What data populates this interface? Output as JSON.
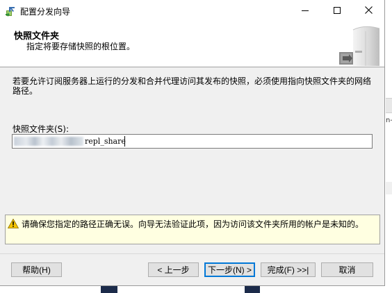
{
  "window": {
    "title": "配置分发向导"
  },
  "header": {
    "title": "快照文件夹",
    "subtitle": "指定将要存储快照的根位置。"
  },
  "body": {
    "description": "若要允许订阅服务器上运行的分发和合并代理访问其发布的快照，必须使用指向快照文件夹的网络路径。",
    "folder_label": "快照文件夹(S):",
    "folder_value": "repl_share"
  },
  "warning": {
    "text": "请确保您指定的路径正确无误。向导无法验证此项，因为访问该文件夹所用的帐户是未知的。"
  },
  "buttons": {
    "help": "帮助(H)",
    "back": "< 上一步",
    "next": "下一步(N) >",
    "finish": "完成(F) >>|",
    "cancel": "取消"
  },
  "background": {
    "fragment_text": "n-"
  },
  "icons": {
    "app": "wizard-icon",
    "header": "server-folder-icon",
    "warning": "warning-icon",
    "minimize": "minimize-icon",
    "maximize": "maximize-icon",
    "close": "close-icon"
  },
  "colors": {
    "focus_border": "#0078d7",
    "warning_background": "#ffffe1",
    "dialog_background": "#f0f0f0"
  }
}
